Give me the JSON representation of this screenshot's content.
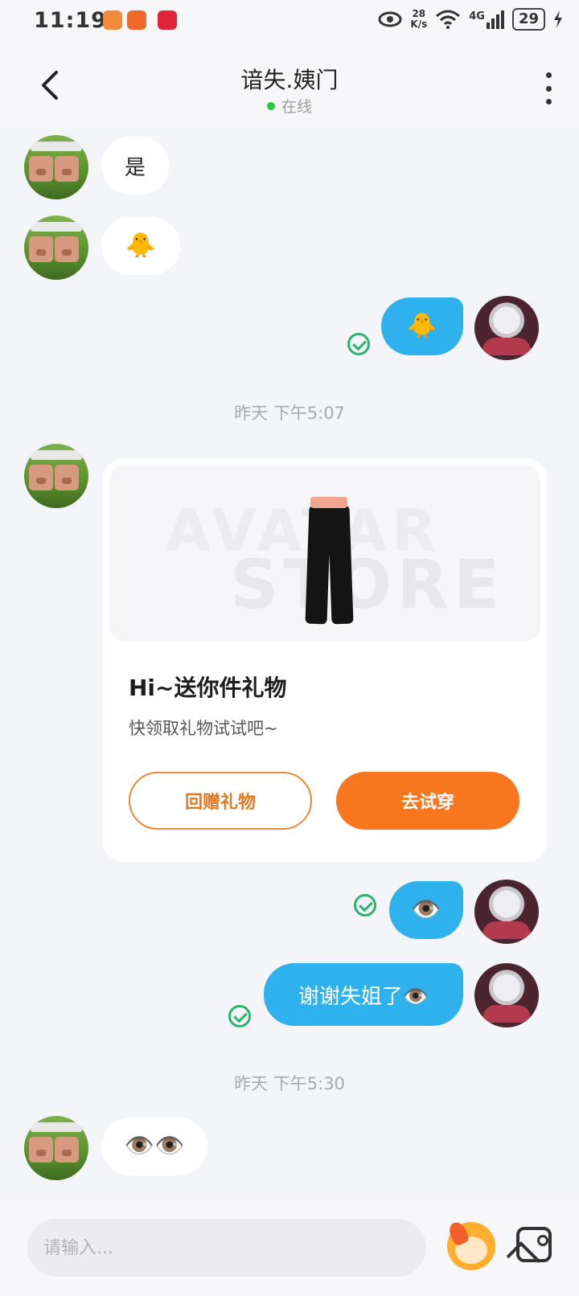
{
  "status_bar": {
    "time": "11:19",
    "net_speed_value": "28",
    "net_speed_unit": "K/s",
    "signal": "4G",
    "battery": "29",
    "icons": [
      "eye-icon",
      "wifi-icon",
      "signal-icon",
      "battery-icon",
      "charging-icon"
    ]
  },
  "header": {
    "name": "谙失.姨门",
    "status": "在线",
    "status_color": "#28c840"
  },
  "messages": {
    "m1": "是",
    "m2": "🐥",
    "m3": "🐥",
    "m4_eye": "👁️",
    "m5": "谢谢失姐了👁️",
    "m6": "👁️👁️"
  },
  "timestamps": {
    "t1": "昨天 下午5:07",
    "t2": "昨天 下午5:30"
  },
  "gift_card": {
    "brand_line1": "AVATAR",
    "brand_line2": "STORE",
    "title": "Hi~送你件礼物",
    "subtitle": "快领取礼物试试吧~",
    "return_gift_label": "回赠礼物",
    "try_on_label": "去试穿",
    "accent": "#f8761e"
  },
  "input": {
    "placeholder": "请输入..."
  },
  "colors": {
    "outgoing_bubble": "#2fb1ee",
    "read_check": "#2bb36f",
    "background": "#f4f5f9"
  }
}
